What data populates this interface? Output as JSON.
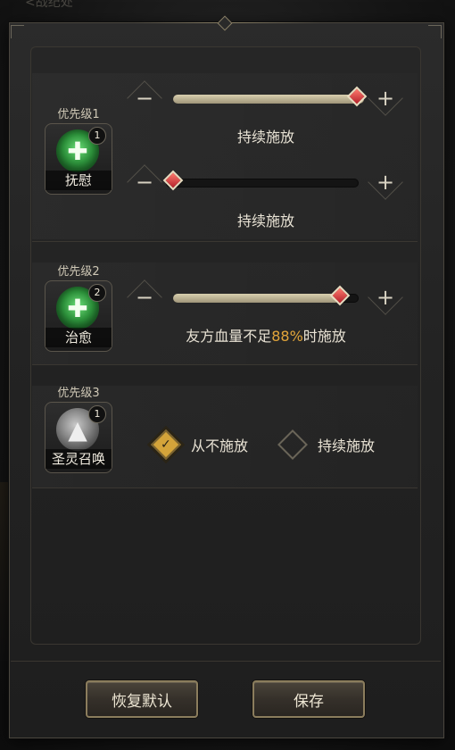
{
  "background": {
    "title": "<战纪处"
  },
  "colors": {
    "accent": "#e2a53a",
    "knob": "#c8323a",
    "fill": "#c2b895"
  },
  "rows": [
    {
      "priority": "优先级1",
      "skill_name": "抚慰",
      "skill_level": "1",
      "icon": "green-cross-heal-icon",
      "sliders": [
        {
          "minus": "−",
          "plus": "+",
          "value_fraction": 1.0,
          "caption": "持续施放"
        },
        {
          "minus": "−",
          "plus": "+",
          "value_fraction": 0.0,
          "caption": "持续施放"
        }
      ]
    },
    {
      "priority": "优先级2",
      "skill_name": "治愈",
      "skill_level": "2",
      "icon": "green-multi-cross-heal-icon",
      "sliders": [
        {
          "minus": "−",
          "plus": "+",
          "value_fraction": 0.9,
          "caption_prefix": "友方血量不足",
          "caption_value": "88%",
          "caption_suffix": "时施放"
        }
      ]
    },
    {
      "priority": "优先级3",
      "skill_name": "圣灵召唤",
      "skill_level": "1",
      "icon": "grey-spirit-summon-icon",
      "options": [
        {
          "label": "从不施放",
          "checked": true,
          "check_glyph": "✓"
        },
        {
          "label": "持续施放",
          "checked": false
        }
      ]
    }
  ],
  "footer": {
    "reset_label": "恢复默认",
    "save_label": "保存"
  }
}
